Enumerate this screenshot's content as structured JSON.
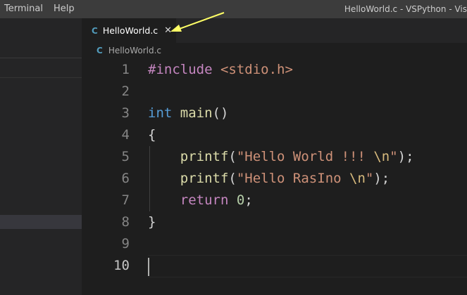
{
  "menu": {
    "items": [
      "Terminal",
      "Help"
    ]
  },
  "window": {
    "title": "HelloWorld.c - VSPython - Vis"
  },
  "tab": {
    "icon_glyph": "C",
    "icon_name": "c-language-icon",
    "label": "HelloWorld.c",
    "close_glyph": "✕"
  },
  "breadcrumb": {
    "icon_glyph": "C",
    "file": "HelloWorld.c"
  },
  "editor": {
    "line_numbers": [
      "1",
      "2",
      "3",
      "4",
      "5",
      "6",
      "7",
      "8",
      "9",
      "10"
    ],
    "lines": [
      [
        {
          "t": "#include",
          "c": "dir"
        },
        {
          "t": " ",
          "c": "punc"
        },
        {
          "t": "<stdio.h>",
          "c": "hdr"
        }
      ],
      [],
      [
        {
          "t": "int",
          "c": "kw"
        },
        {
          "t": " ",
          "c": "punc"
        },
        {
          "t": "main",
          "c": "fn"
        },
        {
          "t": "()",
          "c": "punc"
        }
      ],
      [
        {
          "t": "{",
          "c": "punc"
        }
      ],
      [
        {
          "t": "    ",
          "c": "punc"
        },
        {
          "t": "printf",
          "c": "fn"
        },
        {
          "t": "(",
          "c": "punc"
        },
        {
          "t": "\"Hello World !!! ",
          "c": "str"
        },
        {
          "t": "\\n",
          "c": "esc"
        },
        {
          "t": "\"",
          "c": "str"
        },
        {
          "t": ");",
          "c": "punc"
        }
      ],
      [
        {
          "t": "    ",
          "c": "punc"
        },
        {
          "t": "printf",
          "c": "fn"
        },
        {
          "t": "(",
          "c": "punc"
        },
        {
          "t": "\"Hello RasIno ",
          "c": "str"
        },
        {
          "t": "\\n",
          "c": "esc"
        },
        {
          "t": "\"",
          "c": "str"
        },
        {
          "t": ");",
          "c": "punc"
        }
      ],
      [
        {
          "t": "    ",
          "c": "punc"
        },
        {
          "t": "return",
          "c": "ctrl"
        },
        {
          "t": " ",
          "c": "punc"
        },
        {
          "t": "0",
          "c": "num"
        },
        {
          "t": ";",
          "c": "punc"
        }
      ],
      [
        {
          "t": "}",
          "c": "punc"
        }
      ],
      [],
      []
    ],
    "current_line": "10"
  },
  "colors": {
    "annotation_arrow": "#ffff66",
    "c_icon": "#519aba",
    "editor_bg": "#1e1e1e"
  }
}
